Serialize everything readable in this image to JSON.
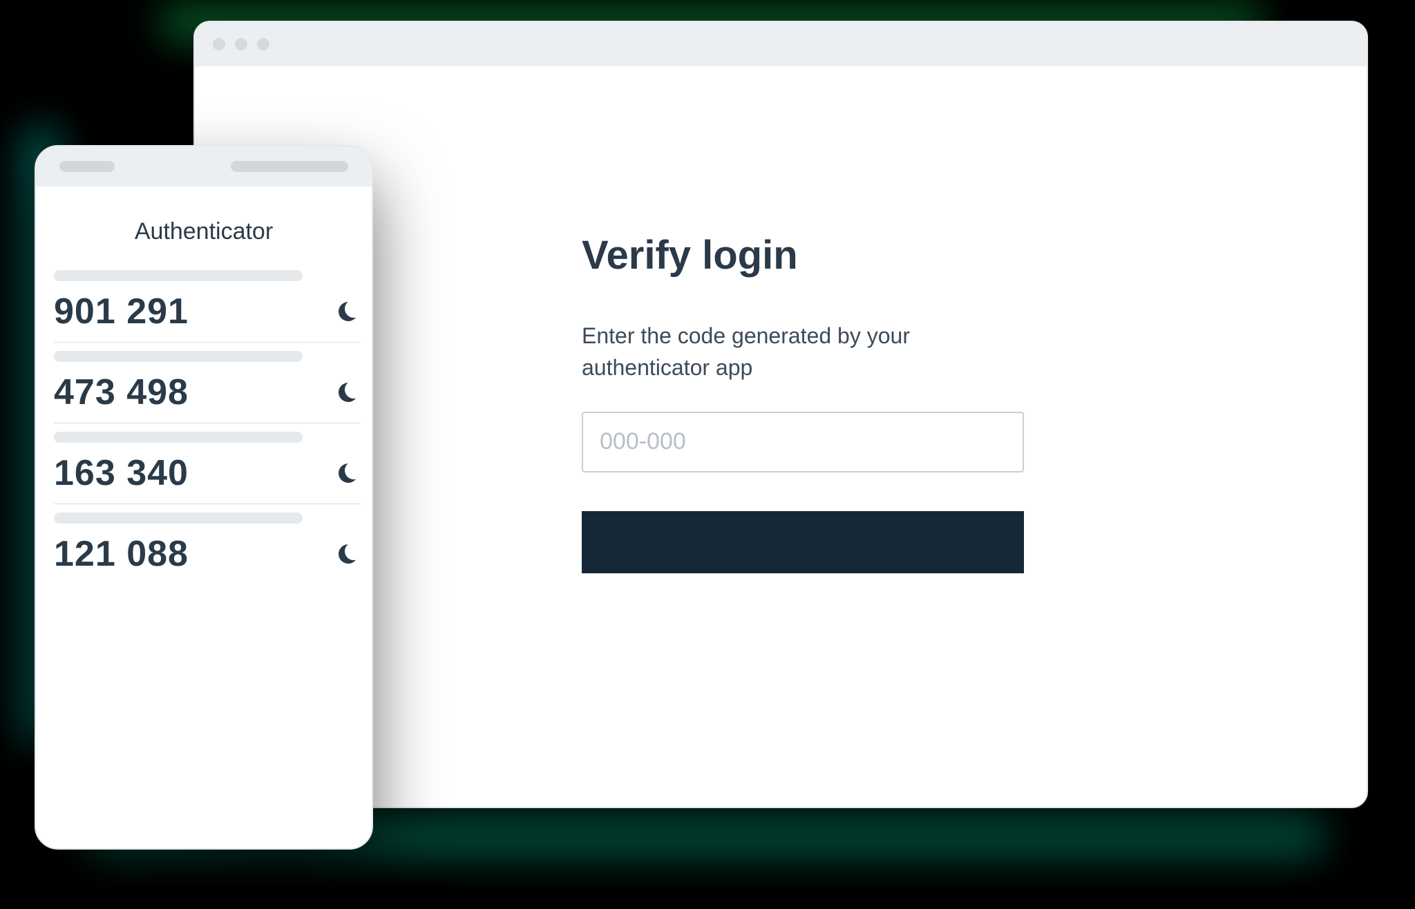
{
  "browser": {
    "verify": {
      "title": "Verify login",
      "description": "Enter the code generated by your authenticator app",
      "input_placeholder": "000-000",
      "submit_label": ""
    }
  },
  "phone": {
    "title": "Authenticator",
    "codes": [
      {
        "value": "901 291"
      },
      {
        "value": "473 498"
      },
      {
        "value": "163 340"
      },
      {
        "value": "121 088"
      }
    ]
  }
}
